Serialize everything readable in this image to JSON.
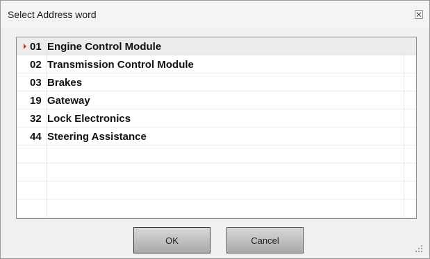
{
  "dialog": {
    "title": "Select Address word",
    "close_icon": "close-icon",
    "colors": {
      "selected_row": "#ececec",
      "marker_arrow": "#c0392b",
      "button": "#bdbdbd"
    }
  },
  "list": {
    "selected_index": 0,
    "items": [
      {
        "label": "01  Engine Control Module"
      },
      {
        "label": "02  Transmission Control Module"
      },
      {
        "label": "03  Brakes"
      },
      {
        "label": "19  Gateway"
      },
      {
        "label": "32  Lock Electronics"
      },
      {
        "label": "44  Steering Assistance"
      }
    ]
  },
  "buttons": {
    "ok_label": "OK",
    "cancel_label": "Cancel"
  }
}
